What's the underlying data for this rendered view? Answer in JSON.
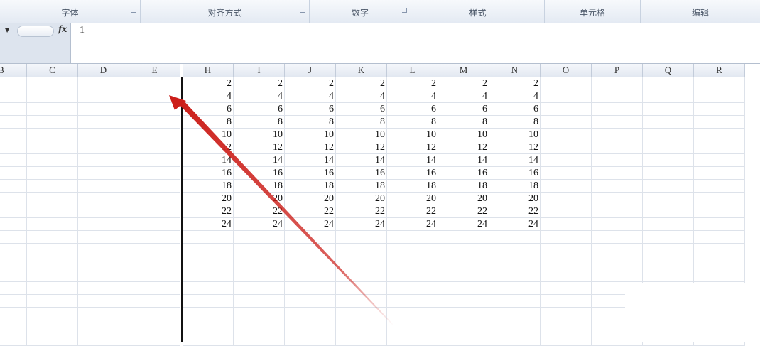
{
  "ribbon": {
    "groups": [
      {
        "label": "字体",
        "launcher": true
      },
      {
        "label": "对齐方式",
        "launcher": true
      },
      {
        "label": "数字",
        "launcher": true
      },
      {
        "label": "样式",
        "launcher": false
      },
      {
        "label": "单元格",
        "launcher": false
      },
      {
        "label": "编辑",
        "launcher": false
      }
    ]
  },
  "formula_bar": {
    "fx_label": "fx",
    "value": "1"
  },
  "columns_left": [
    "B",
    "C",
    "D",
    "E"
  ],
  "columns_right": [
    "H",
    "I",
    "J",
    "K",
    "L",
    "M",
    "N",
    "O",
    "P",
    "Q",
    "R"
  ],
  "data_columns": [
    "H",
    "I",
    "J",
    "K",
    "L",
    "M",
    "N"
  ],
  "row_values": [
    2,
    4,
    6,
    8,
    10,
    12,
    14,
    16,
    18,
    20,
    22,
    24
  ],
  "annotation": {
    "type": "red-arrow",
    "color": "#cc1f1a"
  }
}
